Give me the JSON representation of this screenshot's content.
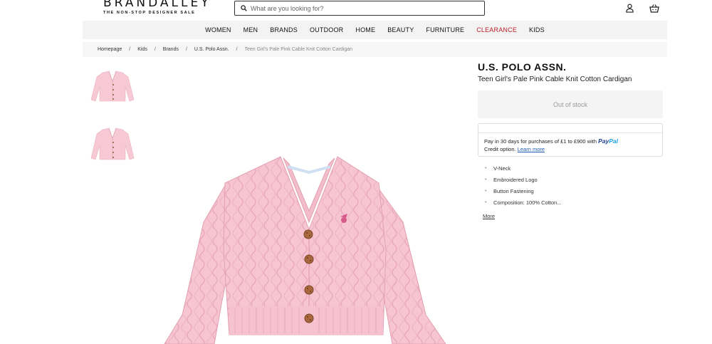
{
  "header": {
    "logo_main": "BRANDALLEY",
    "logo_sub": "THE NON-STOP DESIGNER SALE",
    "search_placeholder": "What are you looking for?",
    "account_icon": "account-icon",
    "basket_icon": "basket-icon"
  },
  "nav": {
    "items": [
      {
        "label": "WOMEN"
      },
      {
        "label": "MEN"
      },
      {
        "label": "BRANDS"
      },
      {
        "label": "OUTDOOR"
      },
      {
        "label": "HOME"
      },
      {
        "label": "BEAUTY"
      },
      {
        "label": "FURNITURE"
      },
      {
        "label": "CLEARANCE",
        "color": "#b51f2b"
      },
      {
        "label": "KIDS"
      }
    ]
  },
  "breadcrumb": {
    "items": [
      "Homepage",
      "Kids",
      "Brands",
      "U.S. Polo Assn.",
      "Teen Girl's Pale Pink Cable Knit Cotton Cardigan"
    ],
    "separator": "/"
  },
  "product": {
    "brand": "U.S. POLO ASSN.",
    "title": "Teen Girl's Pale Pink Cable Knit Cotton Cardigan",
    "stock_status": "Out of stock",
    "paypal": {
      "text_line1": "Pay in 30 days for purchases of £1 to £900 with",
      "logo_part1": "Pay",
      "logo_part2": "Pal",
      "text_line2": "Credit option.",
      "learn_more": "Learn more"
    },
    "features": [
      "V-Neck",
      "Embroidered Logo",
      "Button Fastening",
      "Composition: 100% Cotton..."
    ],
    "more_label": "More",
    "color": "#f6c4d0"
  }
}
